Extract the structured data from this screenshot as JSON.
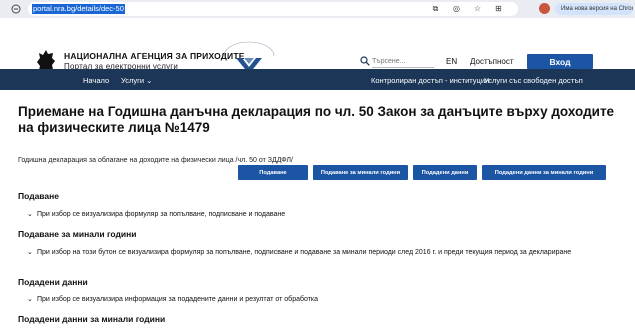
{
  "browser": {
    "url": "portal.nra.bg/details/dec-50",
    "update_text": "Има нова версия на Chrome"
  },
  "header": {
    "agency_name": "НАЦИОНАЛНА АГЕНЦИЯ ЗА ПРИХОДИТЕ",
    "portal_name": "Портал за електронни услуги",
    "search_placeholder": "Търсене...",
    "lang": "EN",
    "accessibility": "Достъпност",
    "login": "Вход"
  },
  "nav": {
    "home": "Начало",
    "services": "Услуги",
    "controlled": "Контролиран достъп - институции",
    "free": "Услуги със свободен достъп"
  },
  "page": {
    "title": "Приемане на Годишна данъчна декларация по чл. 50 Закон за данъците върху доходите на физическите лица №1479",
    "subtitle": "Годишна декларация за облагане на доходите на физически лица /чл. 50 от ЗДДФЛ/",
    "buttons": [
      "Подаване",
      "Подаване за минали години",
      "Подадени данни",
      "Подадени данни за минали години"
    ],
    "sections": [
      {
        "title": "Подаване",
        "text": "При избор се визуализира формуляр за попълване, подписване и подаване"
      },
      {
        "title": "Подаване за минали години",
        "text": "При избор на този бутон се визуализира формуляр за попълване, подписване и подаване за минали периоди след 2016 г. и преди текущия период за деклариране"
      },
      {
        "title": "Подадени данни",
        "text": "При избор се визуализира информация за подадените данни и резултат от обработка"
      },
      {
        "title": "Подадени данни за минали години",
        "text": ""
      }
    ]
  }
}
